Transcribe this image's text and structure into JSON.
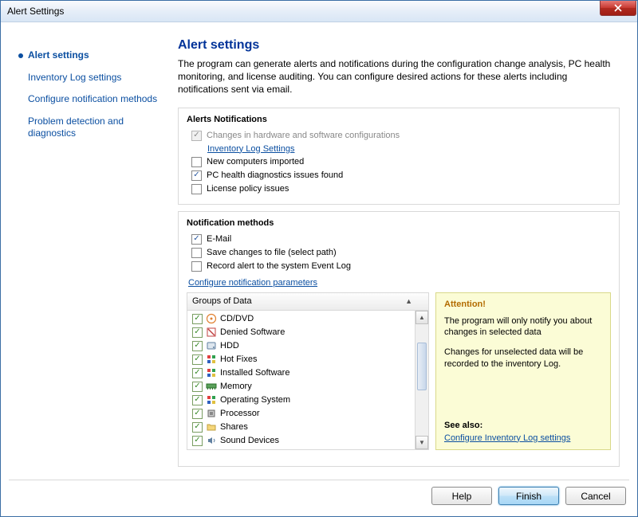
{
  "window": {
    "title": "Alert Settings"
  },
  "nav": [
    {
      "label": "Alert settings",
      "selected": true
    },
    {
      "label": "Inventory Log settings",
      "selected": false
    },
    {
      "label": "Configure notification methods",
      "selected": false
    },
    {
      "label": "Problem detection and diagnostics",
      "selected": false
    }
  ],
  "main": {
    "heading": "Alert settings",
    "description": "The program can generate alerts and notifications during the configuration change analysis, PC health monitoring, and license auditing. You can configure desired actions for these alerts including notifications sent via email."
  },
  "alerts_group": {
    "title": "Alerts Notifications",
    "items": [
      {
        "label": "Changes in hardware and software configurations",
        "checked": true,
        "disabled": true,
        "sublink": "Inventory Log Settings"
      },
      {
        "label": "New computers imported",
        "checked": false,
        "disabled": false
      },
      {
        "label": "PC health diagnostics issues found",
        "checked": true,
        "disabled": false
      },
      {
        "label": "License policy issues",
        "checked": false,
        "disabled": false
      }
    ]
  },
  "methods_group": {
    "title": "Notification methods",
    "items": [
      {
        "label": "E-Mail",
        "checked": true
      },
      {
        "label": "Save changes to file (select path)",
        "checked": false
      },
      {
        "label": "Record alert to the system Event Log",
        "checked": false
      }
    ],
    "config_link": "Configure notification parameters"
  },
  "data_list": {
    "header": "Groups of Data",
    "items": [
      {
        "label": "CD/DVD",
        "icon": "disc",
        "color": "#e08030"
      },
      {
        "label": "Denied Software",
        "icon": "denied",
        "color": "#c04040"
      },
      {
        "label": "HDD",
        "icon": "hdd",
        "color": "#6080a0"
      },
      {
        "label": "Hot Fixes",
        "icon": "grid",
        "color": "#3060c0"
      },
      {
        "label": "Installed Software",
        "icon": "grid",
        "color": "#30a050"
      },
      {
        "label": "Memory",
        "icon": "ram",
        "color": "#30a050"
      },
      {
        "label": "Operating System",
        "icon": "grid",
        "color": "#3060c0"
      },
      {
        "label": "Processor",
        "icon": "cpu",
        "color": "#606060"
      },
      {
        "label": "Shares",
        "icon": "folder",
        "color": "#e0b040"
      },
      {
        "label": "Sound Devices",
        "icon": "sound",
        "color": "#6080a0"
      }
    ]
  },
  "attention": {
    "title": "Attention!",
    "p1": "The program will only notify you about changes in selected data",
    "p2": "Changes for unselected data will be recorded to the inventory Log.",
    "see_also_label": "See also:",
    "see_also_link": "Configure Inventory Log settings"
  },
  "footer": {
    "help": "Help",
    "finish": "Finish",
    "cancel": "Cancel"
  }
}
